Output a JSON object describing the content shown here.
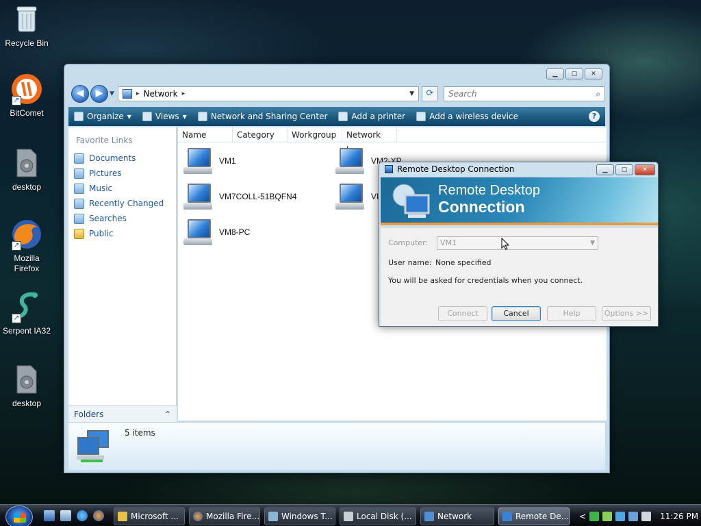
{
  "desktop": {
    "icons": [
      {
        "label": "Recycle Bin"
      },
      {
        "label": "BitComet"
      },
      {
        "label": "desktop"
      },
      {
        "label": "Mozilla\nFirefox"
      },
      {
        "label": "Serpent IA32"
      },
      {
        "label": "desktop"
      }
    ]
  },
  "explorer": {
    "address": {
      "crumb": "Network",
      "sep": "▸"
    },
    "search_placeholder": "Search",
    "toolbar": {
      "organize": "Organize",
      "views": "Views",
      "network_sharing": "Network and Sharing Center",
      "add_printer": "Add a printer",
      "add_wireless": "Add a wireless device"
    },
    "nav": {
      "title": "Favorite Links",
      "links": [
        "Documents",
        "Pictures",
        "Music",
        "Recently Changed",
        "Searches",
        "Public"
      ],
      "folders_label": "Folders"
    },
    "columns": [
      "Name",
      "Category",
      "Workgroup",
      "Network lo..."
    ],
    "files": [
      "VM1",
      "VM7COLL-51BQFN4",
      "VM8-PC",
      "VM2-XP",
      "VI"
    ],
    "status": "5 items"
  },
  "rdc": {
    "title": "Remote Desktop Connection",
    "banner_line1": "Remote Desktop",
    "banner_line2": "Connection",
    "computer_label": "Computer:",
    "computer_value": "VM1",
    "username_label": "User name:",
    "username_value": "None specified",
    "info": "You will be asked for credentials when you connect.",
    "buttons": {
      "connect": "Connect",
      "cancel": "Cancel",
      "help": "Help",
      "options": "Options >>"
    }
  },
  "taskbar": {
    "tasks": [
      "Microsoft ...",
      "Mozilla Fire...",
      "Windows T...",
      "Local Disk (...",
      "Network",
      "Remote De..."
    ],
    "tray_chevron": "<",
    "clock": "11:26 PM"
  },
  "colors": {
    "accent": "#1d5a7f",
    "link": "#1e57a8",
    "banner_stripe": "#f29a3a"
  }
}
